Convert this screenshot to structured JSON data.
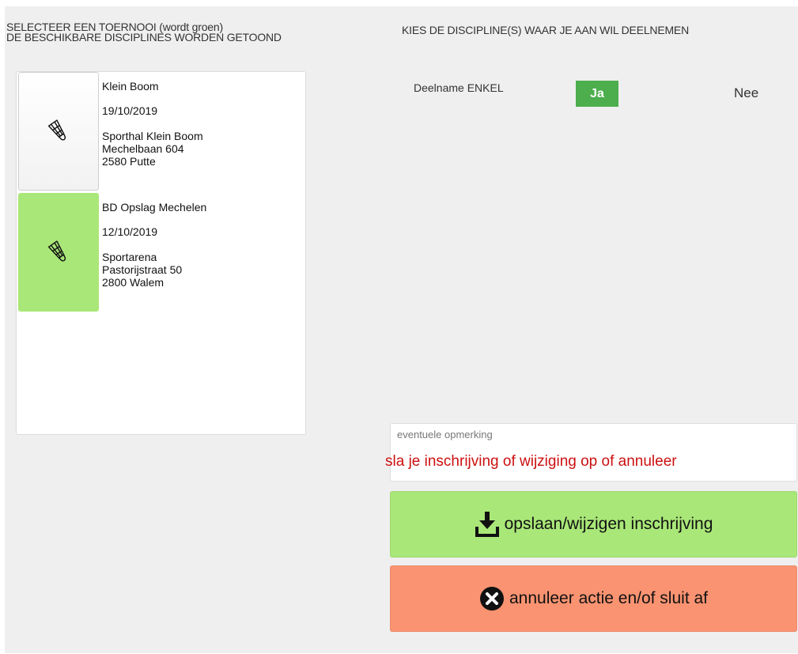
{
  "headings": {
    "left_line1": "SELECTEER EEN TOERNOOI (wordt groen)",
    "left_line2": "DE BESCHIKBARE DISCIPLINES WORDEN GETOOND",
    "right": "KIES DE DISCIPLINE(S) WAAR JE AAN WIL DEELNEMEN"
  },
  "tournaments": [
    {
      "name": "Klein Boom",
      "date": "19/10/2019",
      "venue": "Sporthal Klein Boom",
      "street": "Mechelbaan 604",
      "city": "2580 Putte",
      "selected": false,
      "icon": "shuttlecock-icon"
    },
    {
      "name": "BD Opslag Mechelen",
      "date": "12/10/2019",
      "venue": "Sportarena",
      "street": "Pastorijstraat 50",
      "city": "2800 Walem",
      "selected": true,
      "icon": "shuttlecock-icon"
    }
  ],
  "discipline": {
    "label": "Deelname ENKEL",
    "yes": "Ja",
    "no": "Nee",
    "selected": "Ja"
  },
  "remark": {
    "placeholder": "eventuele opmerking",
    "value": ""
  },
  "notice": "sla je inschrijving of wijziging op of annuleer",
  "actions": {
    "save_label": "opslaan/wijzigen inschrijving",
    "save_icon": "download-icon",
    "cancel_label": "annuleer actie en/of sluit af",
    "cancel_icon": "close-circle-icon"
  },
  "colors": {
    "selected_green": "#a9e778",
    "yes_button": "#4cae4c",
    "save_button": "#a9e778",
    "cancel_button": "#fa9371",
    "notice_text": "#cc1010",
    "background": "#efefef"
  }
}
